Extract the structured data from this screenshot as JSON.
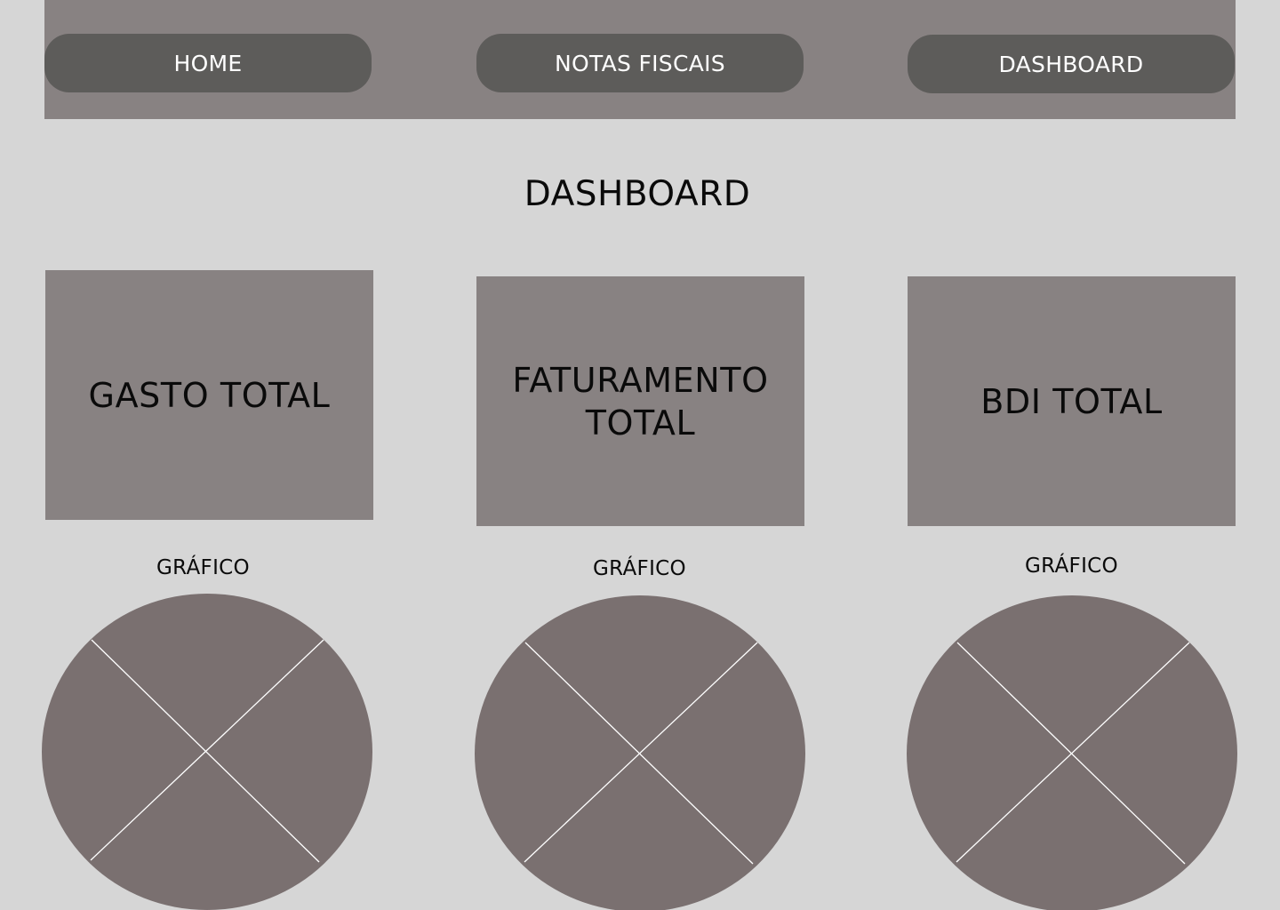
{
  "nav": {
    "items": [
      {
        "label": "HOME"
      },
      {
        "label": "NOTAS FISCAIS"
      },
      {
        "label": "DASHBOARD"
      }
    ]
  },
  "page": {
    "title": "DASHBOARD"
  },
  "cards": [
    {
      "label": "GASTO TOTAL"
    },
    {
      "label": "FATURAMENTO TOTAL"
    },
    {
      "label": "BDI TOTAL"
    }
  ],
  "charts": [
    {
      "label": "GRÁFICO"
    },
    {
      "label": "GRÁFICO"
    },
    {
      "label": "GRÁFICO"
    }
  ],
  "colors": {
    "background": "#d6d6d6",
    "navbar": "#888282",
    "nav_button": "#5d5c5a",
    "card": "#888282",
    "pie_fill": "#7a7070",
    "pie_divider": "#ffffff"
  }
}
